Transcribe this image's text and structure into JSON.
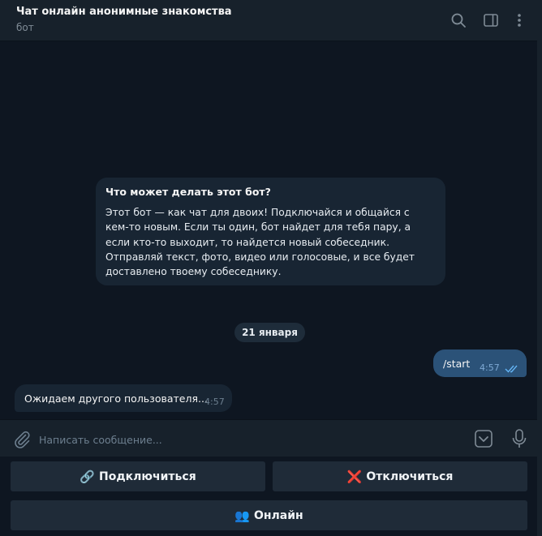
{
  "header": {
    "title": "Чат онлайн анонимные знакомства",
    "subtitle": "бот",
    "icons": [
      "search-icon",
      "sidebar-toggle-icon",
      "more-vertical-icon"
    ]
  },
  "intro_card": {
    "title": "Что может делать этот бот?",
    "text": "Этот бот — как чат для двоих! Подключайся и общайся с кем-то новым. Если ты один, бот найдет для тебя пару, а если кто-то выходит, то найдется новый собеседник. Отправляй текст, фото, видео или голосовые, и все будет доставлено твоему собеседнику."
  },
  "date_separator": "21 января",
  "messages": [
    {
      "direction": "outgoing",
      "text": "/start",
      "time": "4:57",
      "status": "read"
    },
    {
      "direction": "incoming",
      "text": "Ожидаем другого пользователя...",
      "time": "4:57"
    }
  ],
  "composer": {
    "placeholder": "Написать сообщение...",
    "icons": [
      "attach-icon",
      "bot-keyboard-icon",
      "microphone-icon"
    ]
  },
  "keyboard": {
    "connect": {
      "emoji": "🔗",
      "label": "Подключиться"
    },
    "disconnect": {
      "emoji": "❌",
      "label": "Отключиться"
    },
    "online": {
      "emoji": "👥",
      "label": "Онлайн"
    }
  },
  "colors": {
    "background": "#0e1621",
    "panel": "#17212b",
    "incoming_bubble": "#182533",
    "outgoing_bubble": "#2b5278",
    "read_ticks": "#64b5f6",
    "keyboard_button": "#1f2b38"
  }
}
